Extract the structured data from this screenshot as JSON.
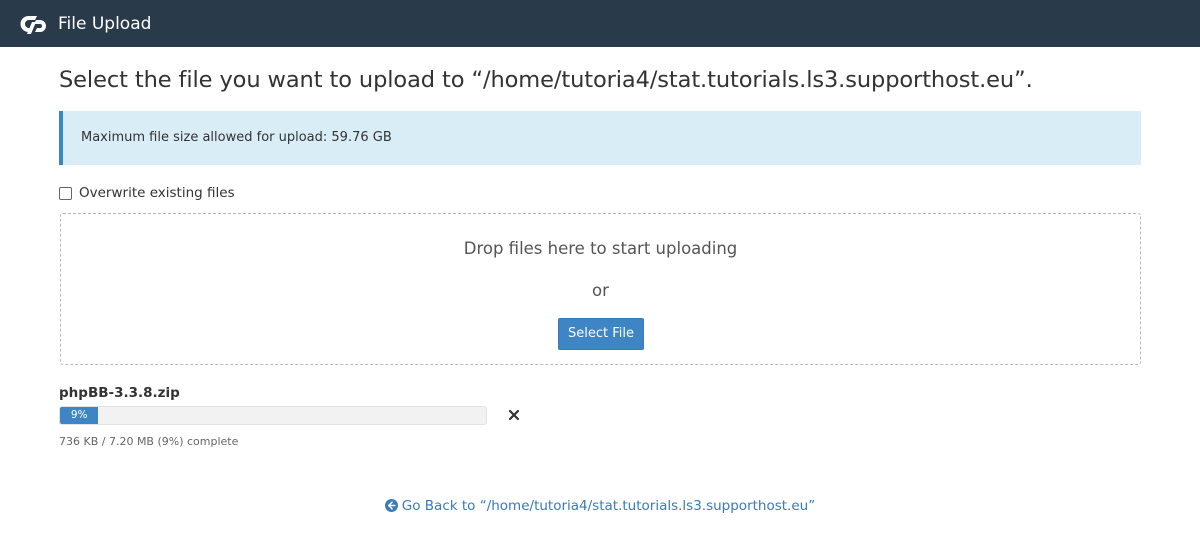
{
  "app": {
    "title": "File Upload",
    "logo_icon": "cpanel-logo-icon"
  },
  "page": {
    "heading": "Select the file you want to upload to “/home/tutoria4/stat.tutorials.ls3.supporthost.eu”."
  },
  "alert": {
    "text": "Maximum file size allowed for upload: 59.76 GB"
  },
  "options": {
    "overwrite_label": "Overwrite existing files",
    "overwrite_checked": false
  },
  "dropzone": {
    "drop_text": "Drop files here to start uploading",
    "or_text": "or",
    "select_button": "Select File"
  },
  "upload": {
    "filename": "phpBB-3.3.8.zip",
    "progress_percent": 9,
    "progress_label": "9%",
    "status": "736 KB / 7.20 MB (9%) complete",
    "cancel_icon": "close-icon"
  },
  "footer": {
    "go_back": "Go Back to “/home/tutoria4/stat.tutorials.ls3.supporthost.eu”",
    "go_back_icon": "arrow-left-circle-icon"
  },
  "colors": {
    "header_bg": "#293a4a",
    "accent": "#3e85c5",
    "alert_bg": "#d9edf7",
    "alert_border": "#3a87c8"
  }
}
